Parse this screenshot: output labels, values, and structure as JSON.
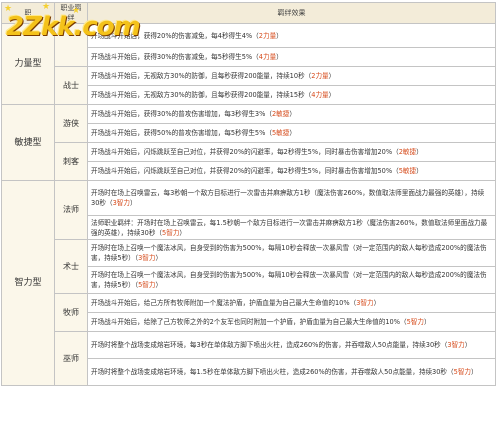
{
  "logo": {
    "text": "2Zkk.com"
  },
  "header": {
    "col_type": "职",
    "col_job": "职业羁绊",
    "col_effect": "羁绊效果"
  },
  "groups": [
    {
      "type": "力量型",
      "jobs": [
        {
          "name": "",
          "rows": [
            {
              "text": "开场战斗开始后，获得20%的伤害减免，每4秒得生4%（",
              "tag": "2力量",
              "tail": "）"
            },
            {
              "text": "开场战斗开始后，获得30%的伤害减免，每5秒得生5%（",
              "tag": "4力量",
              "tail": "）"
            }
          ]
        },
        {
          "name": "战士",
          "rows": [
            {
              "text": "开场战斗开始后，无视敌方30%的防御，且每秒获得200能量，持续10秒（",
              "tag": "2力量",
              "tail": "）"
            },
            {
              "text": "开场战斗开始后，无视敌方30%的防御，且每秒获得200能量，持续15秒（",
              "tag": "4力量",
              "tail": "）"
            }
          ]
        }
      ]
    },
    {
      "type": "敏捷型",
      "jobs": [
        {
          "name": "游侠",
          "rows": [
            {
              "text": "开场战斗开始后，获得30%的普攻伤害增加，每3秒得生3%（",
              "tag": "2敏捷",
              "tail": "）"
            },
            {
              "text": "开场战斗开始后，获得50%的普攻伤害增加，每5秒得生5%（",
              "tag": "5敏捷",
              "tail": "）"
            }
          ]
        },
        {
          "name": "刺客",
          "rows": [
            {
              "text": "开场战斗开始后，闪烁跳跃至自己对位，并获得20%的闪避率，每2秒得生5%，同时暴击伤害增加20%（",
              "tag": "2敏捷",
              "tail": "）"
            },
            {
              "text": "开场战斗开始后，闪烁跳跃至自己对位，并获得20%的闪避率，每2秒得生5%，同时暴击伤害增加50%（",
              "tag": "5敏捷",
              "tail": "）"
            }
          ]
        }
      ]
    },
    {
      "type": "智力型",
      "jobs": [
        {
          "name": "法师",
          "rows": [
            {
              "text": "开场时在场上召唤雷云，每3秒朝一个敌方目标进行一次雷击并麻痹敌方1秒（魔法伤害260%，数值取法师里面战力最强的英雄），持续30秒（",
              "tag": "3智力",
              "tail": "）"
            },
            {
              "text": "法师职业羁绊：开场时在场上召唤雷云，每1.5秒朝一个敌方目标进行一次雷击并麻痹敌方1秒（魔法伤害260%，数值取法师里面战力最强的英雄），持续30秒（",
              "tag": "5智力",
              "tail": "）"
            }
          ]
        },
        {
          "name": "术士",
          "rows": [
            {
              "text": "开场时在场上召唤一个魔法冰风，自身受到的伤害为500%，每隔10秒会释放一次暴风雪（对一定范围内的敌人每秒造成200%的魔法伤害，持续5秒）（",
              "tag": "3智力",
              "tail": "）"
            },
            {
              "text": "开场时在场上召唤一个魔法冰风，自身受到的伤害为500%，每隔10秒会释放一次暴风雪（对一定范围内的敌人每秒造成200%的魔法伤害，持续5秒）（",
              "tag": "5智力",
              "tail": "）"
            }
          ]
        },
        {
          "name": "牧师",
          "rows": [
            {
              "text": "开场战斗开始后，给己方所有牧师附加一个魔法护盾，护盾血量为自己最大生命值的10%（",
              "tag": "3智力",
              "tail": "）"
            },
            {
              "text": "开场战斗开始后，给除了己方牧师之外的2个友军也同时附加一个护盾，护盾血量为自己最大生命值的10%（",
              "tag": "5智力",
              "tail": "）"
            }
          ]
        },
        {
          "name": "巫师",
          "rows": [
            {
              "text": "开场时将整个战场变成熔岩环境，每3秒在单体敌方脚下喷出火柱，造成260%的伤害，并吞噬敌人50点能量，持续30秒（",
              "tag": "3智力",
              "tail": "）"
            },
            {
              "text": "开场时将整个战场变成熔岩环境，每1.5秒在单体敌方脚下喷出火柱，造成260%的伤害，并吞噬敌人50点能量，持续30秒（",
              "tag": "5智力",
              "tail": "）"
            }
          ]
        }
      ]
    }
  ]
}
